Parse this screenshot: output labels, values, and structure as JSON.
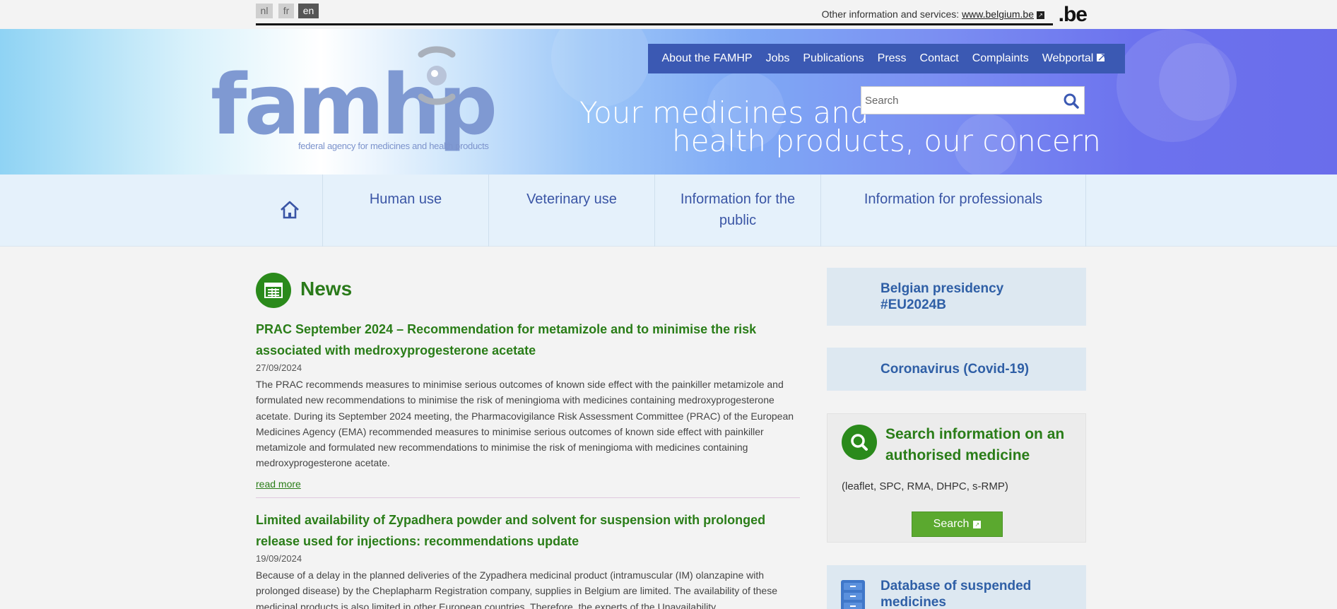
{
  "languages": [
    {
      "code": "nl",
      "active": false
    },
    {
      "code": "fr",
      "active": false
    },
    {
      "code": "en",
      "active": true
    }
  ],
  "topbar": {
    "other_label": "Other information and services:",
    "belgium_link": "www.belgium.be",
    "be_logo": ".be"
  },
  "header": {
    "logo_text": "famhp",
    "logo_sub": "federal agency for medicines and health products",
    "slogan_line1": "Your medicines and",
    "slogan_line2": "health products, our concern",
    "nav": [
      "About the FAMHP",
      "Jobs",
      "Publications",
      "Press",
      "Contact",
      "Complaints",
      "Webportal"
    ],
    "search_placeholder": "Search"
  },
  "subnav": {
    "items": [
      "Human use",
      "Veterinary use",
      "Information for the public",
      "Information for professionals"
    ]
  },
  "news": {
    "heading": "News",
    "read_more": "read more",
    "articles": [
      {
        "title": "PRAC September 2024 – Recommendation for metamizole and to minimise the risk associated with medroxyprogesterone acetate",
        "date": "27/09/2024",
        "body": "The PRAC recommends measures to minimise serious outcomes of known side effect with the painkiller metamizole and formulated new recommendations to minimise the risk of meningioma with medicines containing medroxyprogesterone acetate. During its September 2024 meeting, the Pharmacovigilance Risk Assessment Committee (PRAC) of the European Medicines Agency (EMA) recommended measures to minimise serious outcomes of known side effect with painkiller metamizole and formulated new recommendations to minimise the risk of meningioma with medicines containing medroxyprogesterone acetate."
      },
      {
        "title": "Limited availability of Zypadhera powder and solvent for suspension with prolonged release used for injections: recommendations update",
        "date": "19/09/2024",
        "body": "Because of a delay in the planned deliveries of the Zypadhera medicinal product (intramuscular (IM) olanzapine with prolonged disease) by the Cheplapharm Registration company, supplies in Belgium are limited. The availability of these medicinal products is also limited in other European countries. Therefore, the experts of the Unavailability"
      }
    ]
  },
  "sidebar": {
    "presidency": "Belgian presidency #EU2024B",
    "covid": "Coronavirus (Covid-19)",
    "search_title": "Search information on an authorised medicine",
    "search_text": "(leaflet, SPC, RMA, DHPC, s-RMP)",
    "search_button": "Search",
    "database": "Database of suspended medicines"
  },
  "colors": {
    "brand_blue": "#3b59b3",
    "green": "#2a7d18",
    "button_green": "#5ba92f"
  }
}
